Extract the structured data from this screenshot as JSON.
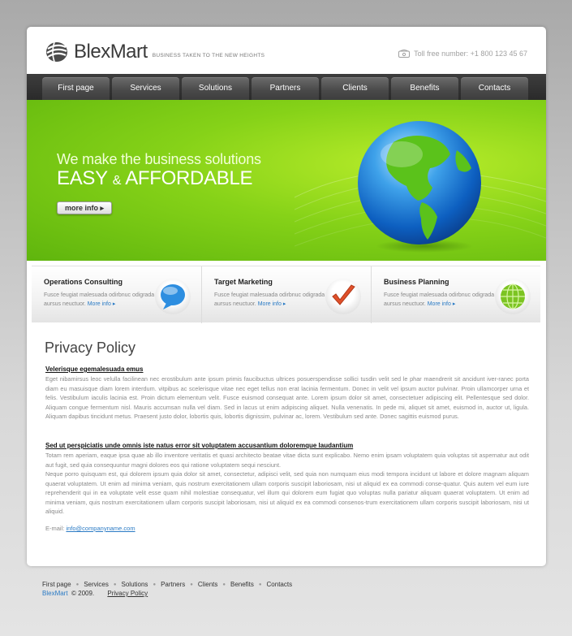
{
  "header": {
    "logo_text": "BlexMart",
    "tagline": "BUSINESS TAKEN TO THE NEW HEIGHTS",
    "phone_label": "Toll free number:",
    "phone_number": "+1 800 123 45 67"
  },
  "nav": {
    "items": [
      "First page",
      "Services",
      "Solutions",
      "Partners",
      "Clients",
      "Benefits",
      "Contacts"
    ]
  },
  "hero": {
    "line1": "We make the business solutions",
    "line2a": "EASY",
    "amp": "&",
    "line2b": "AFFORDABLE",
    "button": "more info ▸"
  },
  "services": [
    {
      "title": "Operations Consulting",
      "text": "Fusce feugiat malesuada odirbnuc odigrada aursus neuctuor.",
      "more": "More info ▸",
      "icon": "chat-bubble-icon"
    },
    {
      "title": "Target Marketing",
      "text": "Fusce feugiat malesuada odirbnuc odigrada aursus neuctuor.",
      "more": "More info ▸",
      "icon": "checkmark-icon"
    },
    {
      "title": "Business Planning",
      "text": "Fusce feugiat malesuada odirbnuc odigrada aursus neuctuor.",
      "more": "More info ▸",
      "icon": "globe-icon"
    }
  ],
  "content": {
    "title": "Privacy Policy",
    "section1_heading": "Velerisque egemalesuada emus",
    "section1_text": "Eget nibamirsus leoc velulla facilinean nec erostibulum ante ipsum primis faucibuctus ultrices posuerspendisse sollici tusdin velit sed le phar maendrerit sit ancidunt iver-ranec porta diam eu masuisque diam lorem interdum. vitpibus ac scelerisque vitae nec eget tellus non erat lacinia fermentum. Donec in velit vel ipsum auctor pulvinar. Proin ullamcorper urna et felis. Vestibulum iaculis lacinia est. Proin dictum elementum velit. Fusce euismod consequat ante. Lorem ipsum dolor sit amet, consectetuer adipiscing elit. Pellentesque sed dolor. Aliquam congue fermentum nisl. Mauris accumsan nulla vel diam. Sed in lacus ut enim adipiscing aliquet. Nulla venenatis. In pede mi, aliquet sit amet, euismod in, auctor ut, ligula. Aliquam dapibus tincidunt metus. Praesent justo dolor, lobortis quis, lobortis dignissim, pulvinar ac, lorem. Vestibulum sed ante. Donec sagittis euismod purus.",
    "section2_heading": "Sed ut perspiciatis unde omnis iste natus error sit voluptatem accusantium doloremque laudantium",
    "section2_text1": "Totam rem aperiam, eaque ipsa quae ab illo inventore veritatis et quasi architecto beatae vitae dicta sunt explicabo. Nemo enim ipsam voluptatem quia voluptas sit aspernatur aut odit aut fugit, sed quia consequuntur magni dolores eos qui ratione voluptatem sequi nesciunt.",
    "section2_text2": "Neque porro quisquam est, qui dolorem ipsum quia dolor sit amet, consectetur, adipisci velit, sed quia non numquam eius modi tempora incidunt ut labore et dolore magnam aliquam quaerat voluptatem. Ut enim ad minima veniam, quis nostrum exercitationem ullam corporis suscipit laboriosam, nisi ut aliquid ex ea commodi conse-quatur. Quis autem vel eum iure reprehenderit qui in ea voluptate velit esse quam nihil molestiae consequatur, vel illum qui dolorem eum fugiat quo voluptas nulla pariatur aliquam quaerat voluptatem. Ut enim ad minima veniam, quis nostrum exercitationem ullam corporis suscipit laboriosam, nisi ut aliquid ex ea commodi consenos-trum exercitationem ullam corporis suscipit laboriosam, nisi ut aliquid.",
    "email_label": "E-mail:",
    "email": "info@companyname.com"
  },
  "footer": {
    "links": [
      "First page",
      "Services",
      "Solutions",
      "Partners",
      "Clients",
      "Benefits",
      "Contacts"
    ],
    "separator": "●",
    "brand": "BlexMart",
    "copyright": "© 2009.",
    "privacy": "Privacy Policy"
  },
  "colors": {
    "accent_green": "#86d218",
    "link_blue": "#2b7bc5",
    "nav_dark": "#2a2a2a"
  }
}
